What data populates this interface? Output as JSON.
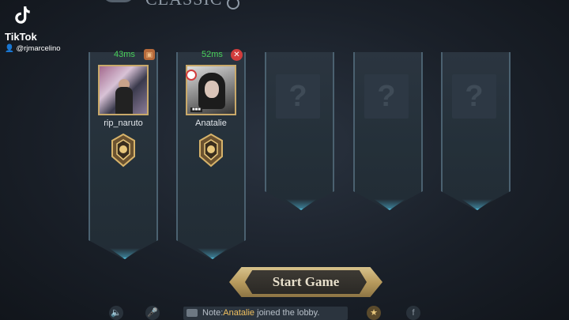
{
  "header": {
    "mode_title": "CLASSIC"
  },
  "watermark": {
    "brand": "TikTok",
    "handle": "@rjmarcelino"
  },
  "players": [
    {
      "name": "rip_naruto",
      "ping": "43ms"
    },
    {
      "name": "Anatalie",
      "ping": "52ms"
    }
  ],
  "empty_slot_symbol": "?",
  "start_button": {
    "label": "Start Game"
  },
  "chat": {
    "prefix": "Note:",
    "who": "Anatalie",
    "message": " joined the lobby."
  },
  "colors": {
    "ping": "#49d05a",
    "accent_cyan": "#4fb7d6",
    "gold": "#c9a96a",
    "kick": "#d23c3c"
  },
  "icons": {
    "speaker": "speaker-icon",
    "mic": "mic-icon",
    "chat": "chat-bubble-icon",
    "shop": "shop-icon",
    "facebook": "facebook-icon"
  }
}
